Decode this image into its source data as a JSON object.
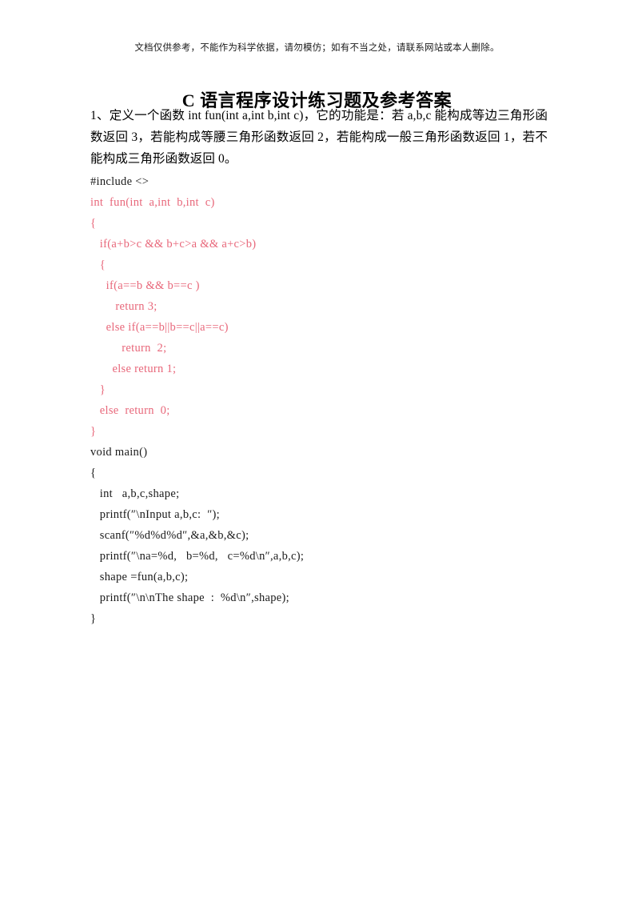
{
  "document": {
    "disclaimer": "文档仅供参考，不能作为科学依据，请勿模仿；如有不当之处，请联系网站或本人删除。",
    "title": "C 语言程序设计练习题及参考答案",
    "question": "1、定义一个函数 int fun(int a,int b,int c)，它的功能是：若 a,b,c 能构成等边三角形函数返回 3，若能构成等腰三角形函数返回 2，若能构成一般三角形函数返回 1，若不能构成三角形函数返回 0。"
  },
  "colors": {
    "code_red": "#e8677a",
    "text_black": "#000000",
    "page_background": "#ffffff"
  },
  "code": {
    "lines": [
      {
        "text": "#include <>",
        "color": "black"
      },
      {
        "text": "int  fun(int  a,int  b,int  c)",
        "color": "red"
      },
      {
        "text": "{",
        "color": "red"
      },
      {
        "text": "   if(a+b>c && b+c>a && a+c>b)",
        "color": "red"
      },
      {
        "text": "   {",
        "color": "red"
      },
      {
        "text": "     if(a==b && b==c )",
        "color": "red"
      },
      {
        "text": "        return 3;",
        "color": "red"
      },
      {
        "text": "     else if(a==b||b==c||a==c)",
        "color": "red"
      },
      {
        "text": "          return  2;",
        "color": "red"
      },
      {
        "text": "       else return 1;",
        "color": "red"
      },
      {
        "text": "   }",
        "color": "red"
      },
      {
        "text": "   else  return  0;",
        "color": "red"
      },
      {
        "text": "}",
        "color": "red"
      },
      {
        "text": "void main()",
        "color": "black"
      },
      {
        "text": "{",
        "color": "black"
      },
      {
        "text": "   int   a,b,c,shape;",
        "color": "black"
      },
      {
        "text": "   printf(″\\nInput a,b,c:  ″);",
        "color": "black"
      },
      {
        "text": "   scanf(″%d%d%d″,&a,&b,&c);",
        "color": "black"
      },
      {
        "text": "   printf(″\\na=%d,   b=%d,   c=%d\\n″,a,b,c);",
        "color": "black"
      },
      {
        "text": "   shape =fun(a,b,c);",
        "color": "black"
      },
      {
        "text": "   printf(″\\n\\nThe shape  :  %d\\n″,shape);",
        "color": "black"
      },
      {
        "text": "}",
        "color": "black"
      }
    ]
  }
}
